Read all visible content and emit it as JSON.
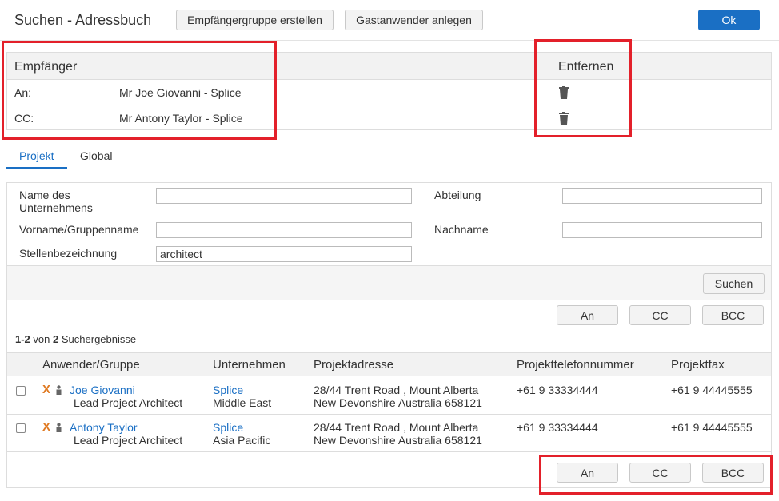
{
  "header": {
    "title": "Suchen - Adressbuch",
    "create_group_label": "Empfängergruppe erstellen",
    "create_guest_label": "Gastanwender anlegen",
    "ok_label": "Ok"
  },
  "recipients": {
    "col_recipient": "Empfänger",
    "col_remove": "Entfernen",
    "rows": [
      {
        "type": "An:",
        "name": "Mr Joe Giovanni - Splice",
        "icon": "trash-icon"
      },
      {
        "type": "CC:",
        "name": "Mr Antony Taylor - Splice",
        "icon": "trash-icon"
      }
    ]
  },
  "tabs": [
    {
      "label": "Projekt",
      "active": true
    },
    {
      "label": "Global",
      "active": false
    }
  ],
  "search": {
    "company_label": "Name des Unternehmens",
    "company_value": "",
    "department_label": "Abteilung",
    "department_value": "",
    "firstname_label": "Vorname/Gruppenname",
    "firstname_value": "",
    "lastname_label": "Nachname",
    "lastname_value": "",
    "jobtitle_label": "Stellenbezeichnung",
    "jobtitle_value": "architect",
    "search_button": "Suchen"
  },
  "results": {
    "btn_to": "An",
    "btn_cc": "CC",
    "btn_bcc": "BCC",
    "count_range": "1-2",
    "count_of": "von",
    "count_total": "2",
    "count_suffix": "Suchergebnisse",
    "columns": [
      "Anwender/Gruppe",
      "Unternehmen",
      "Projektadresse",
      "Projekttelefonnummer",
      "Projektfax"
    ],
    "rows": [
      {
        "name": "Joe Giovanni",
        "role": "Lead Project Architect",
        "company": "Splice",
        "region": "Middle East",
        "address1": "28/44 Trent Road , Mount Alberta",
        "address2": "New Devonshire Australia 658121",
        "phone": "+61 9 33334444",
        "fax": "+61 9 44445555"
      },
      {
        "name": "Antony Taylor",
        "role": "Lead Project Architect",
        "company": "Splice",
        "region": "Asia Pacific",
        "address1": "28/44 Trent Road , Mount Alberta",
        "address2": "New Devonshire Australia 658121",
        "phone": "+61 9 33334444",
        "fax": "+61 9 44445555"
      }
    ]
  },
  "colors": {
    "accent": "#1a6fc4",
    "highlight": "#e3202a",
    "x_icon": "#e07a22"
  }
}
